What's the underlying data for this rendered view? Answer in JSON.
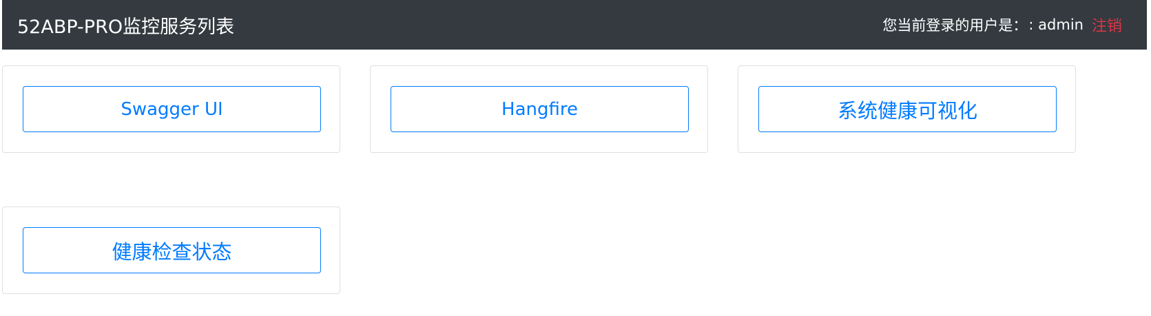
{
  "header": {
    "title": "52ABP-PRO监控服务列表",
    "user_prefix": "您当前登录的用户是：",
    "username": ": admin",
    "logout_label": "注销"
  },
  "services": [
    {
      "label": "Swagger UI"
    },
    {
      "label": "Hangfire"
    },
    {
      "label": "系统健康可视化"
    },
    {
      "label": "健康检查状态"
    }
  ],
  "colors": {
    "navbar_bg": "#343a40",
    "accent": "#007bff",
    "danger": "#dc3545",
    "card_border": "#dfdfdf"
  }
}
